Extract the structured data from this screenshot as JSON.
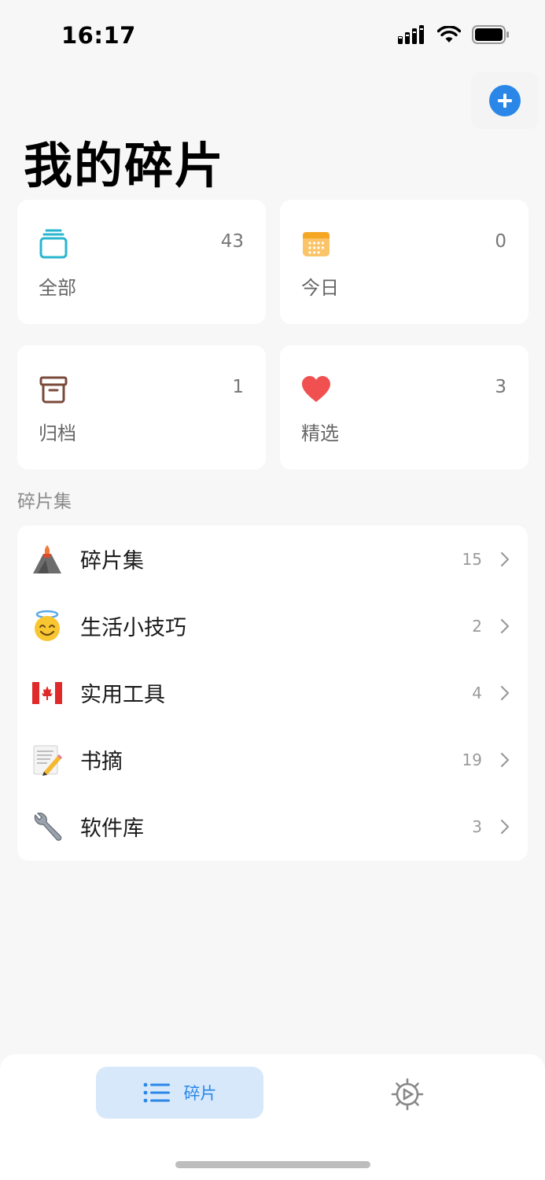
{
  "status_bar": {
    "time": "16:17"
  },
  "header": {
    "title": "我的碎片",
    "add_icon": "plus-icon"
  },
  "summary_cards": [
    {
      "label": "全部",
      "count": "43",
      "icon": "stack-icon",
      "color": "#29b6cf"
    },
    {
      "label": "今日",
      "count": "0",
      "icon": "calendar-icon",
      "color": "#f5a623"
    },
    {
      "label": "归档",
      "count": "1",
      "icon": "archive-box-icon",
      "color": "#7a4a3a"
    },
    {
      "label": "精选",
      "count": "3",
      "icon": "heart-icon",
      "color": "#f05050"
    }
  ],
  "section": {
    "label": "碎片集"
  },
  "collections": [
    {
      "emoji": "🌋",
      "name": "碎片集",
      "count": "15"
    },
    {
      "emoji": "😇",
      "name": "生活小技巧",
      "count": "2"
    },
    {
      "emoji": "🇨🇦",
      "name": "实用工具",
      "count": "4"
    },
    {
      "emoji": "📝",
      "name": "书摘",
      "count": "19"
    },
    {
      "emoji": "🔧",
      "name": "软件库",
      "count": "3"
    }
  ],
  "tab_bar": {
    "tabs": [
      {
        "label": "碎片",
        "icon": "list-icon",
        "active": true
      },
      {
        "label": "",
        "icon": "settings-gear-icon",
        "active": false
      }
    ]
  },
  "colors": {
    "accent": "#2a87e8",
    "active_tab_bg": "#d7e8fb"
  }
}
